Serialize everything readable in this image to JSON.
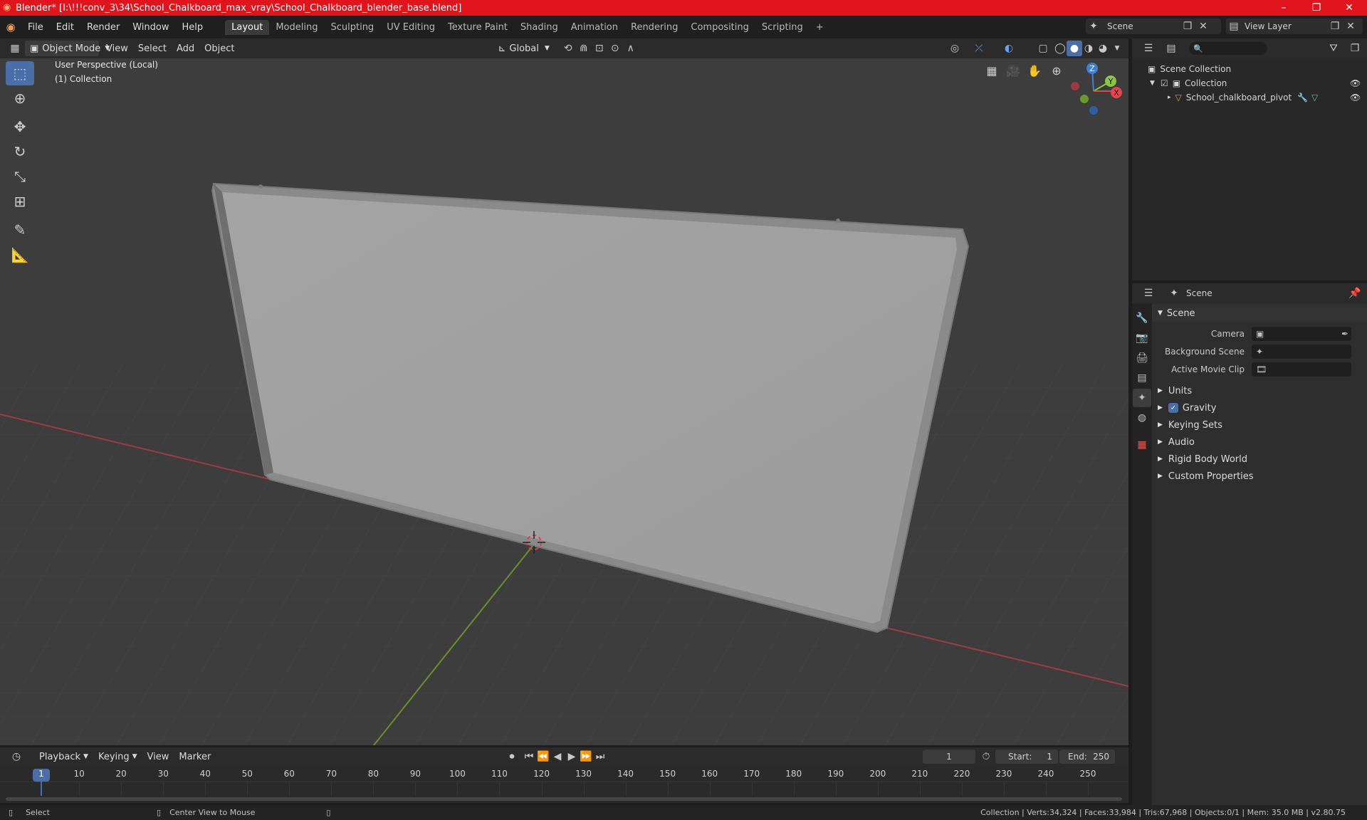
{
  "window": {
    "title": "Blender* [I:\\!!!conv_3\\34\\School_Chalkboard_max_vray\\School_Chalkboard_blender_base.blend]",
    "controls": [
      "–",
      "❐",
      "✕"
    ]
  },
  "menubar": {
    "menus": [
      "File",
      "Edit",
      "Render",
      "Window",
      "Help"
    ],
    "workspaces": [
      "Layout",
      "Modeling",
      "Sculpting",
      "UV Editing",
      "Texture Paint",
      "Shading",
      "Animation",
      "Rendering",
      "Compositing",
      "Scripting"
    ],
    "active_workspace": "Layout",
    "add_tab": "+",
    "scene_name": "Scene",
    "view_layer": "View Layer"
  },
  "viewport": {
    "mode": "Object Mode",
    "menus": [
      "View",
      "Select",
      "Add",
      "Object"
    ],
    "transform_orientation": "Global",
    "perspective_label": "User Perspective (Local)",
    "collection_label": "(1) Collection",
    "gizmo": {
      "x": "X",
      "y": "Y",
      "z": "Z"
    }
  },
  "outliner": {
    "search_placeholder": "",
    "rows": [
      {
        "label": "Scene Collection"
      },
      {
        "label": "Collection"
      },
      {
        "label": "School_chalkboard_pivot"
      }
    ]
  },
  "properties": {
    "header_title": "Scene",
    "panel_title": "Scene",
    "fields": [
      {
        "label": "Camera",
        "value": ""
      },
      {
        "label": "Background Scene",
        "value": ""
      },
      {
        "label": "Active Movie Clip",
        "value": ""
      }
    ],
    "sections": [
      "Units",
      "Gravity",
      "Keying Sets",
      "Audio",
      "Rigid Body World",
      "Custom Properties"
    ],
    "gravity_checked": true
  },
  "timeline": {
    "menus": [
      "Playback",
      "Keying",
      "View",
      "Marker"
    ],
    "current_frame": "1",
    "start_label": "Start:",
    "start_value": "1",
    "end_label": "End:",
    "end_value": "250",
    "ticks": [
      "1",
      "10",
      "20",
      "30",
      "40",
      "50",
      "60",
      "70",
      "80",
      "90",
      "100",
      "110",
      "120",
      "130",
      "140",
      "150",
      "160",
      "170",
      "180",
      "190",
      "200",
      "210",
      "220",
      "230",
      "240",
      "250"
    ]
  },
  "statusbar": {
    "select": "Select",
    "center_view": "Center View to Mouse",
    "stats": "Collection | Verts:34,324 | Faces:33,984 | Tris:67,968 | Objects:0/1 | Mem: 35.0 MB | v2.80.75"
  },
  "colors": {
    "titlebar": "#e0141c",
    "accent": "#4a6fa8",
    "x_axis": "#e8434f",
    "y_axis": "#8cc63e",
    "z_axis": "#3f7fd6"
  }
}
